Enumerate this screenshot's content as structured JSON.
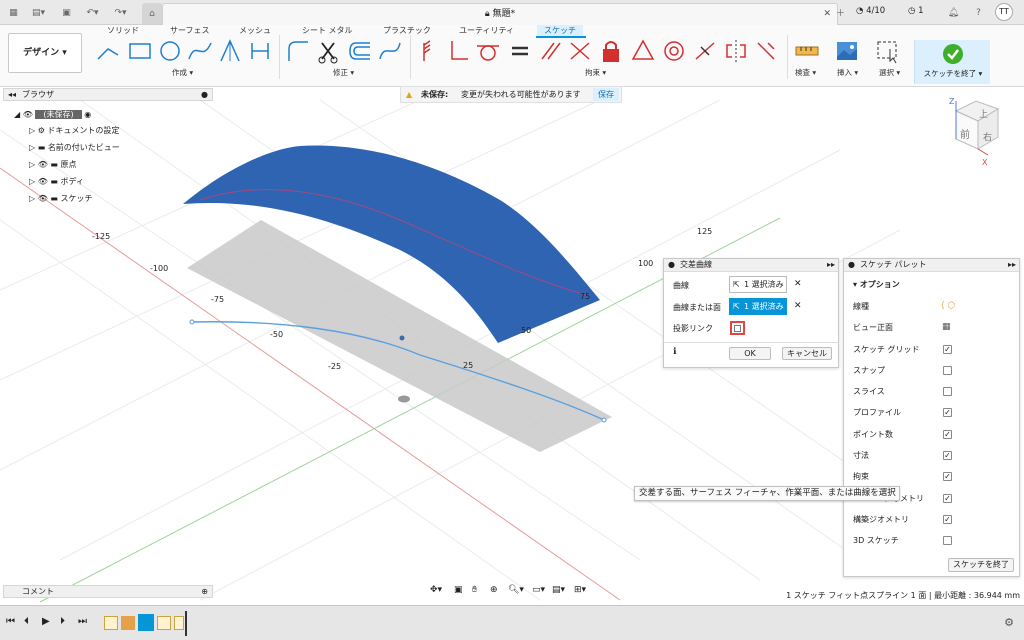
{
  "app": {
    "doc_title": "無題*",
    "job_count": "4/10",
    "clock_count": "1",
    "user_initials": "TT"
  },
  "toolbar": {
    "workspace_label": "デザイン",
    "tabs": [
      "ソリッド",
      "サーフェス",
      "メッシュ",
      "シート メタル",
      "プラスチック",
      "ユーティリティ",
      "スケッチ"
    ],
    "active_tab": "スケッチ",
    "groups": {
      "create": "作成",
      "modify": "修正",
      "constraints": "拘束",
      "inspect": "検査",
      "insert": "挿入",
      "select": "選択",
      "finish": "スケッチを終了"
    }
  },
  "browser": {
    "title": "ブラウザ",
    "root": "(未保存)",
    "items": [
      "ドキュメントの設定",
      "名前の付いたビュー",
      "原点",
      "ボディ",
      "スケッチ"
    ]
  },
  "warning": {
    "label": "未保存:",
    "message": "変更が失われる可能性があります",
    "action": "保存"
  },
  "viewcube": {
    "top": "上",
    "front": "前",
    "right": "右",
    "axis_z": "Z",
    "axis_x": "X"
  },
  "axis_labels": {
    "red": [
      "-125",
      "-100",
      "-75",
      "-50",
      "-25"
    ],
    "green": [
      "125",
      "100",
      "75",
      "50",
      "25"
    ]
  },
  "intersect": {
    "title": "交差曲線",
    "curve_label": "曲線",
    "curve_value": "1 選択済み",
    "surface_label": "曲線または面",
    "surface_value": "1 選択済み",
    "link_label": "投影リンク",
    "ok": "OK",
    "cancel": "キャンセル"
  },
  "palette": {
    "title": "スケッチ パレット",
    "section": "オプション",
    "rows": [
      {
        "label": "線種",
        "checked": null
      },
      {
        "label": "ビュー正面",
        "checked": null
      },
      {
        "label": "スケッチ グリッド",
        "checked": true
      },
      {
        "label": "スナップ",
        "checked": false
      },
      {
        "label": "スライス",
        "checked": false
      },
      {
        "label": "プロファイル",
        "checked": true
      },
      {
        "label": "ポイント数",
        "checked": true
      },
      {
        "label": "寸法",
        "checked": true
      },
      {
        "label": "拘束",
        "checked": true
      },
      {
        "label": "ジオメトリ",
        "checked": true
      },
      {
        "label": "構築ジオメトリ",
        "checked": true
      },
      {
        "label": "3D スケッチ",
        "checked": false
      }
    ],
    "finish_button": "スケッチを終了"
  },
  "tooltip": "交差する面、サーフェス フィーチャ、作業平面、または曲線を選択",
  "comment": "コメント",
  "status": "1 スケッチ フィット点スプライン 1 面 | 最小距離 : 36.944 mm",
  "colors": {
    "accent": "#0696d7",
    "surface": "#2f64b3",
    "active_tab_bg": "#dbeffc",
    "finish_bg": "#dbeffc"
  }
}
